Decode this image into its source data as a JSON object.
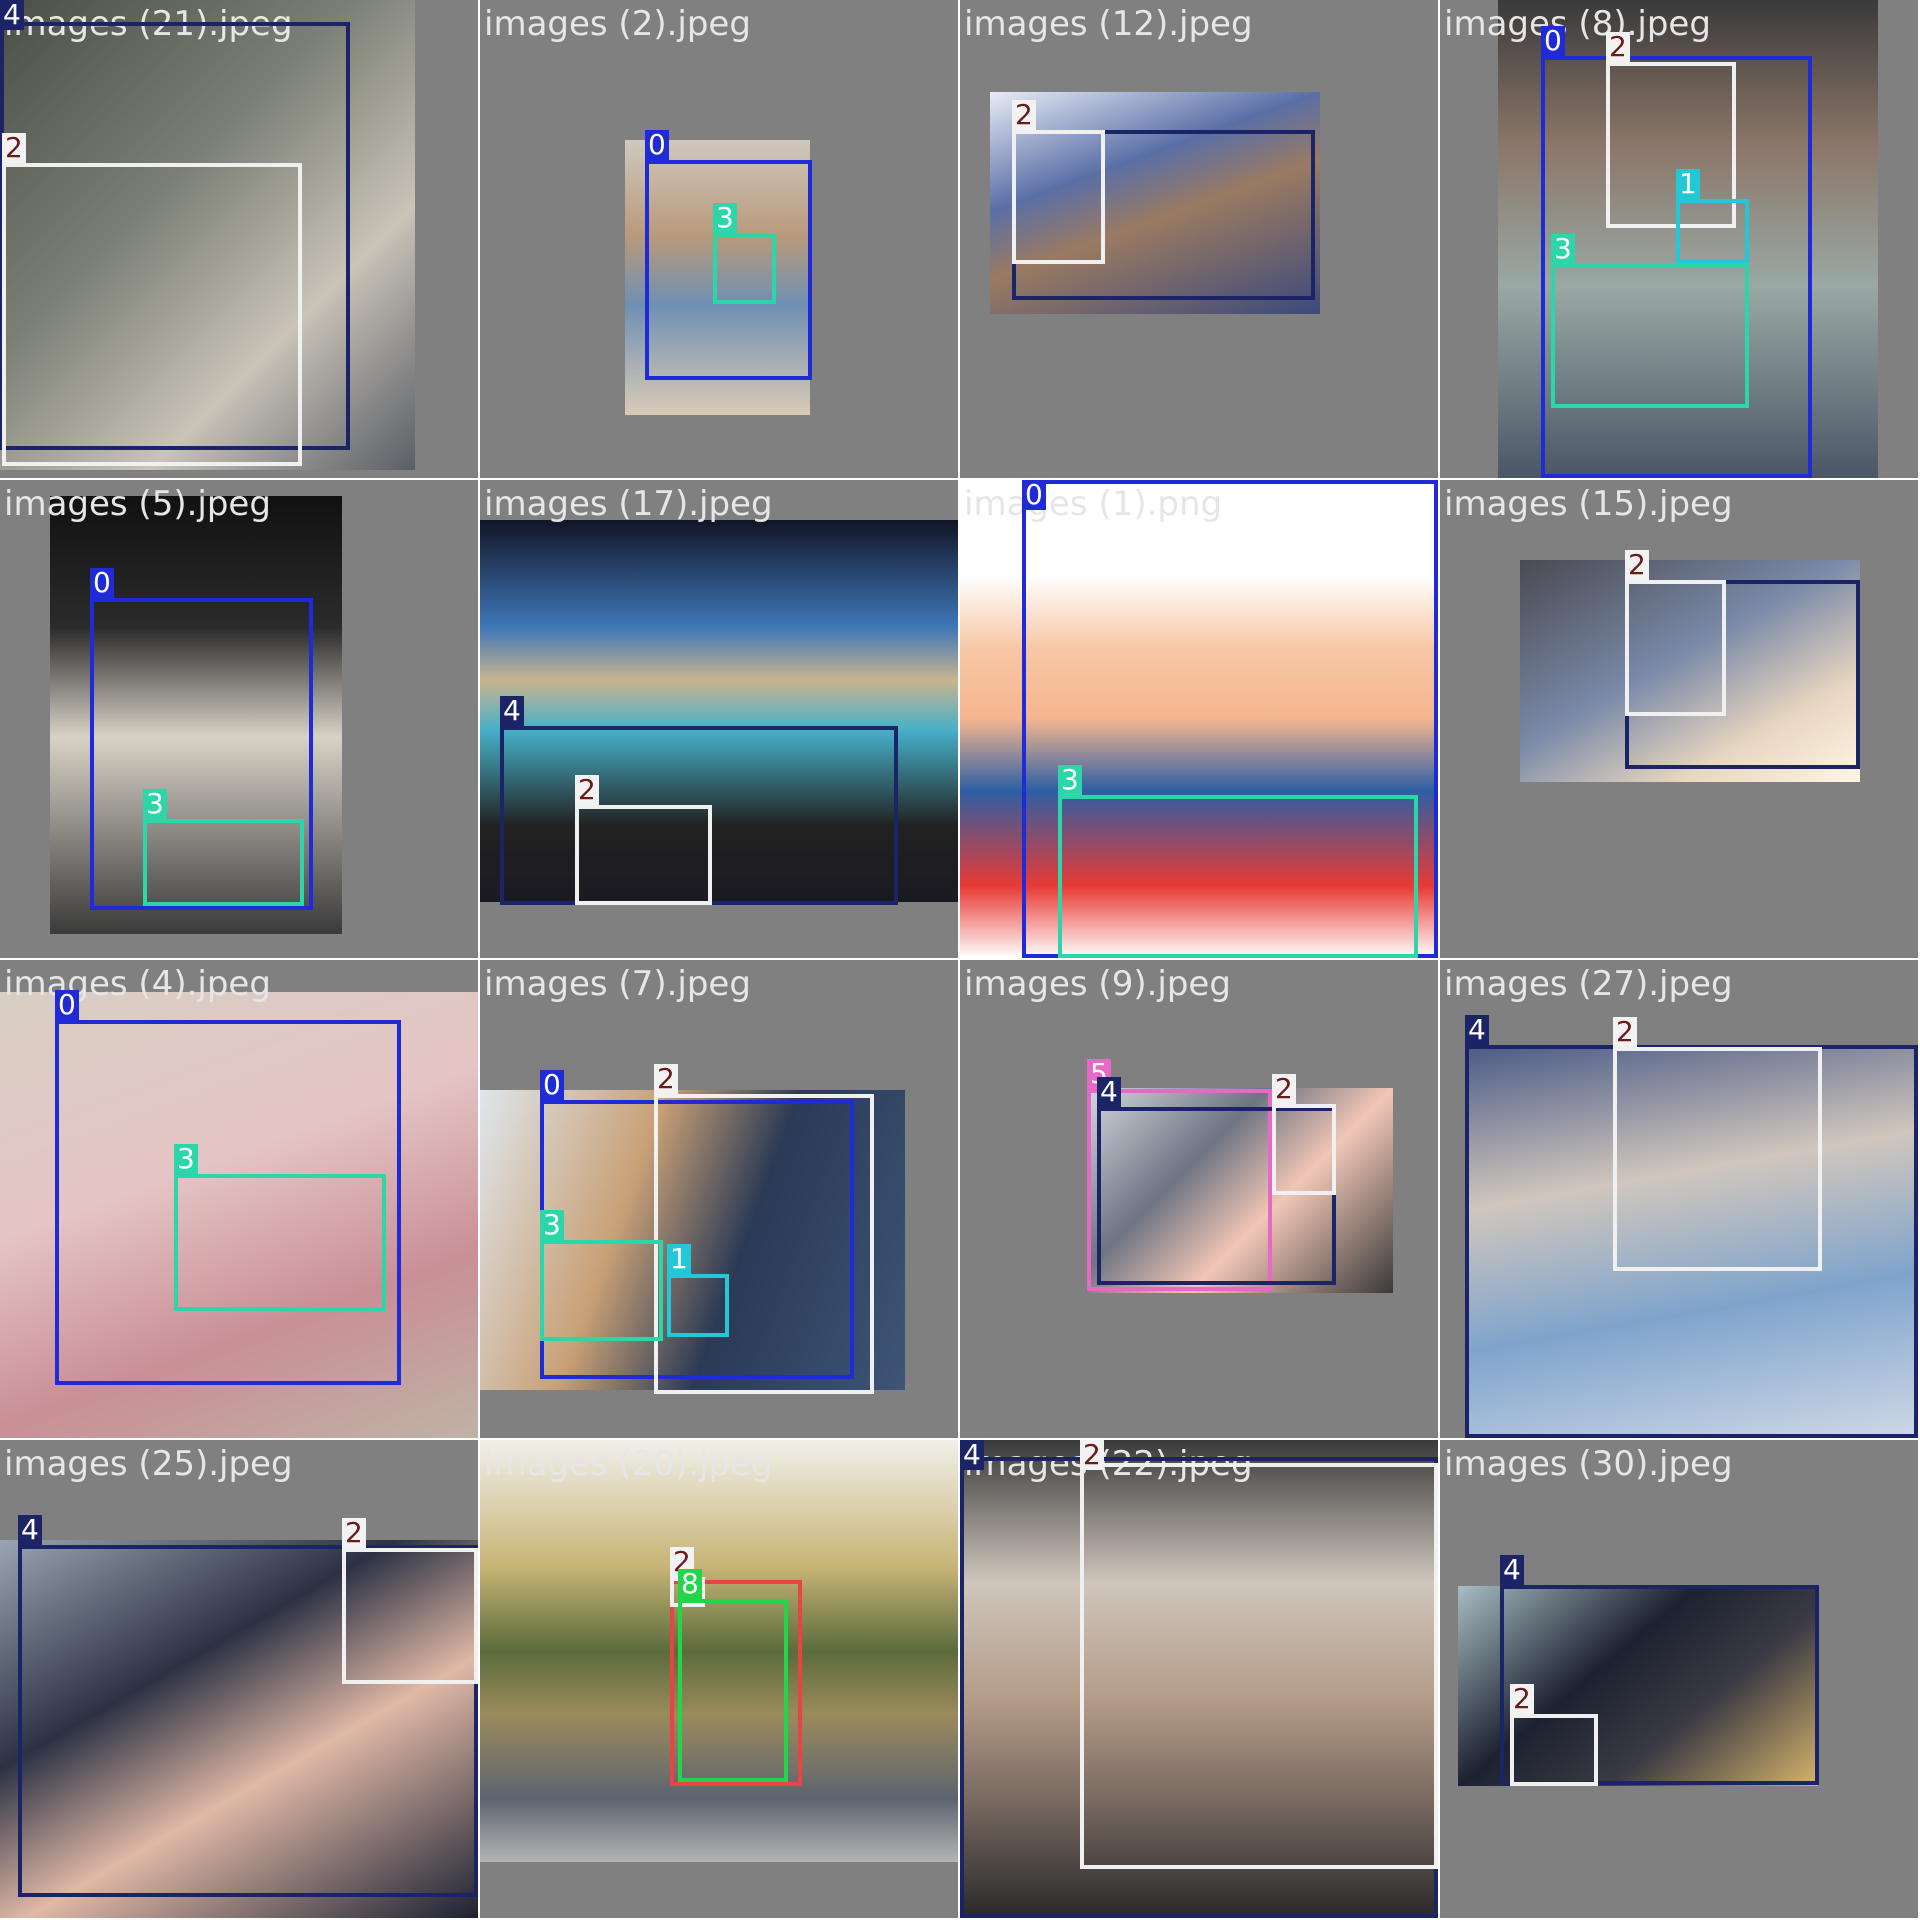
{
  "colors": {
    "class_0": "#1f2bd6",
    "class_1": "#22c8d6",
    "class_2": "#f0f0f0",
    "class_3": "#2cd6a8",
    "class_4": "#1a2466",
    "class_5": "#e868c8",
    "class_6": "#e84444",
    "class_8": "#22d64a",
    "tile_background": "#808080"
  },
  "tiles": [
    {
      "label": "images (21).jpeg",
      "boxes": [
        {
          "cls": "4"
        },
        {
          "cls": "2"
        }
      ]
    },
    {
      "label": "images (2).jpeg",
      "boxes": [
        {
          "cls": "0"
        },
        {
          "cls": "3"
        }
      ]
    },
    {
      "label": "images (12).jpeg",
      "boxes": [
        {
          "cls": "4"
        },
        {
          "cls": "2"
        }
      ]
    },
    {
      "label": "images (8).jpeg",
      "boxes": [
        {
          "cls": "0"
        },
        {
          "cls": "2"
        },
        {
          "cls": "1"
        },
        {
          "cls": "3"
        }
      ]
    },
    {
      "label": "images (5).jpeg",
      "boxes": [
        {
          "cls": "0"
        },
        {
          "cls": "3"
        }
      ]
    },
    {
      "label": "images (17).jpeg",
      "boxes": [
        {
          "cls": "4"
        },
        {
          "cls": "2"
        }
      ]
    },
    {
      "label": "images (1).png",
      "boxes": [
        {
          "cls": "0"
        },
        {
          "cls": "3"
        }
      ]
    },
    {
      "label": "images (15).jpeg",
      "boxes": [
        {
          "cls": "4"
        },
        {
          "cls": "2"
        }
      ]
    },
    {
      "label": "images (4).jpeg",
      "boxes": [
        {
          "cls": "0"
        },
        {
          "cls": "3"
        }
      ]
    },
    {
      "label": "images (7).jpeg",
      "boxes": [
        {
          "cls": "0"
        },
        {
          "cls": "2"
        },
        {
          "cls": "3"
        },
        {
          "cls": "1"
        }
      ]
    },
    {
      "label": "images (9).jpeg",
      "boxes": [
        {
          "cls": "5"
        },
        {
          "cls": "4"
        },
        {
          "cls": "2"
        }
      ]
    },
    {
      "label": "images (27).jpeg",
      "boxes": [
        {
          "cls": "4"
        },
        {
          "cls": "2"
        }
      ]
    },
    {
      "label": "images (25).jpeg",
      "boxes": [
        {
          "cls": "4"
        },
        {
          "cls": "2"
        }
      ]
    },
    {
      "label": "images (20).jpeg",
      "boxes": [
        {
          "cls": "6"
        },
        {
          "cls": "2"
        },
        {
          "cls": "8"
        }
      ]
    },
    {
      "label": "images (22).jpeg",
      "boxes": [
        {
          "cls": "4"
        },
        {
          "cls": "2"
        }
      ]
    },
    {
      "label": "images (30).jpeg",
      "boxes": [
        {
          "cls": "4"
        },
        {
          "cls": "2"
        }
      ]
    }
  ]
}
